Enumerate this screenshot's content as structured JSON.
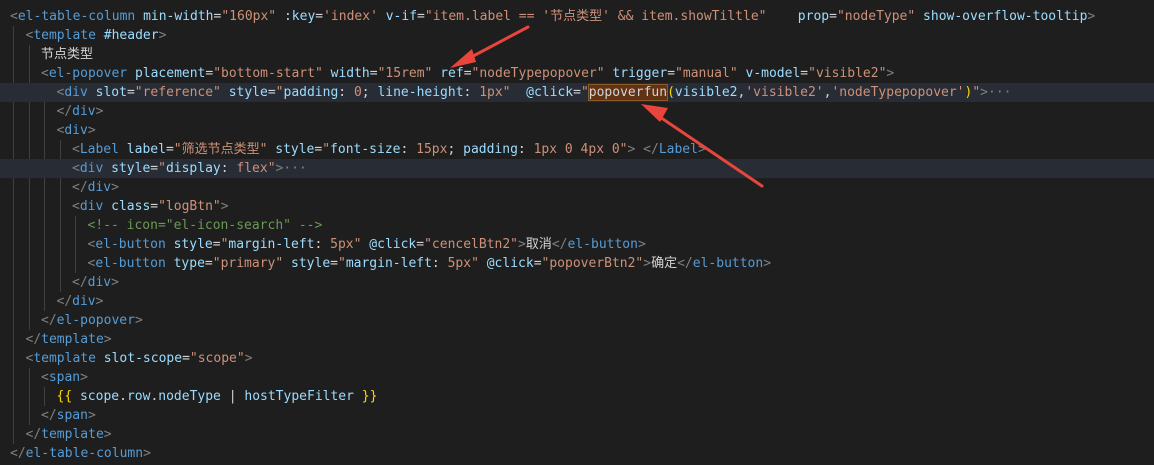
{
  "colors": {
    "background": "#1e1e1e",
    "tag": "#569cd6",
    "attribute": "#9cdcfe",
    "string": "#ce9178",
    "text": "#d4d4d4",
    "comment": "#6a9955",
    "bracket": "#ffd700",
    "annotation_arrow": "#e8463c"
  },
  "code_lines": [
    {
      "indent": 0,
      "highlight": false,
      "tokens": [
        {
          "t": "punc",
          "v": "<"
        },
        {
          "t": "tag",
          "v": "el-table-column"
        },
        {
          "t": "text",
          "v": " "
        },
        {
          "t": "attr",
          "v": "min-width"
        },
        {
          "t": "text",
          "v": "="
        },
        {
          "t": "str",
          "v": "\"160px\""
        },
        {
          "t": "text",
          "v": " "
        },
        {
          "t": "attr",
          "v": ":key"
        },
        {
          "t": "text",
          "v": "="
        },
        {
          "t": "str",
          "v": "'index'"
        },
        {
          "t": "text",
          "v": " "
        },
        {
          "t": "attr",
          "v": "v-if"
        },
        {
          "t": "text",
          "v": "="
        },
        {
          "t": "str",
          "v": "\"item.label == "
        },
        {
          "t": "str",
          "v": "'节点类型'"
        },
        {
          "t": "str",
          "v": " && item.showTiltle\""
        },
        {
          "t": "text",
          "v": "    "
        },
        {
          "t": "attr",
          "v": "prop"
        },
        {
          "t": "text",
          "v": "="
        },
        {
          "t": "str",
          "v": "\"nodeType\""
        },
        {
          "t": "text",
          "v": " "
        },
        {
          "t": "attr",
          "v": "show-overflow-tooltip"
        },
        {
          "t": "punc",
          "v": ">"
        }
      ]
    },
    {
      "indent": 1,
      "highlight": false,
      "tokens": [
        {
          "t": "punc",
          "v": "<"
        },
        {
          "t": "tag",
          "v": "template"
        },
        {
          "t": "text",
          "v": " "
        },
        {
          "t": "attr",
          "v": "#header"
        },
        {
          "t": "punc",
          "v": ">"
        }
      ]
    },
    {
      "indent": 2,
      "highlight": false,
      "tokens": [
        {
          "t": "text",
          "v": "节点类型"
        }
      ]
    },
    {
      "indent": 2,
      "highlight": false,
      "tokens": [
        {
          "t": "punc",
          "v": "<"
        },
        {
          "t": "tag",
          "v": "el-popover"
        },
        {
          "t": "text",
          "v": " "
        },
        {
          "t": "attr",
          "v": "placement"
        },
        {
          "t": "text",
          "v": "="
        },
        {
          "t": "str",
          "v": "\"bottom-start\""
        },
        {
          "t": "text",
          "v": " "
        },
        {
          "t": "attr",
          "v": "width"
        },
        {
          "t": "text",
          "v": "="
        },
        {
          "t": "str",
          "v": "\"15rem\""
        },
        {
          "t": "text",
          "v": " "
        },
        {
          "t": "attr",
          "v": "ref"
        },
        {
          "t": "text",
          "v": "="
        },
        {
          "t": "str",
          "v": "\"nodeTypepopover\""
        },
        {
          "t": "text",
          "v": " "
        },
        {
          "t": "attr",
          "v": "trigger"
        },
        {
          "t": "text",
          "v": "="
        },
        {
          "t": "str",
          "v": "\"manual\""
        },
        {
          "t": "text",
          "v": " "
        },
        {
          "t": "attr",
          "v": "v-model"
        },
        {
          "t": "text",
          "v": "="
        },
        {
          "t": "str",
          "v": "\"visible2\""
        },
        {
          "t": "punc",
          "v": ">"
        }
      ]
    },
    {
      "indent": 3,
      "highlight": true,
      "tokens": [
        {
          "t": "punc",
          "v": "<"
        },
        {
          "t": "tag",
          "v": "div"
        },
        {
          "t": "text",
          "v": " "
        },
        {
          "t": "attr",
          "v": "slot"
        },
        {
          "t": "text",
          "v": "="
        },
        {
          "t": "str",
          "v": "\"reference\""
        },
        {
          "t": "text",
          "v": " "
        },
        {
          "t": "attr",
          "v": "style"
        },
        {
          "t": "text",
          "v": "="
        },
        {
          "t": "str",
          "v": "\""
        },
        {
          "t": "attr",
          "v": "padding"
        },
        {
          "t": "text",
          "v": ": "
        },
        {
          "t": "str",
          "v": "0"
        },
        {
          "t": "text",
          "v": "; "
        },
        {
          "t": "attr",
          "v": "line-height"
        },
        {
          "t": "text",
          "v": ": "
        },
        {
          "t": "str",
          "v": "1px"
        },
        {
          "t": "str",
          "v": "\""
        },
        {
          "t": "text",
          "v": "  "
        },
        {
          "t": "attr",
          "v": "@click"
        },
        {
          "t": "text",
          "v": "="
        },
        {
          "t": "str",
          "v": "\""
        },
        {
          "t": "match",
          "v": "popoverfun"
        },
        {
          "t": "gold",
          "v": "("
        },
        {
          "t": "attr",
          "v": "visible2"
        },
        {
          "t": "text",
          "v": ","
        },
        {
          "t": "str",
          "v": "'visible2'"
        },
        {
          "t": "text",
          "v": ","
        },
        {
          "t": "str",
          "v": "'nodeTypepopover'"
        },
        {
          "t": "gold",
          "v": ")"
        },
        {
          "t": "str",
          "v": "\""
        },
        {
          "t": "punc",
          "v": ">"
        },
        {
          "t": "fold",
          "v": "···"
        }
      ]
    },
    {
      "indent": 3,
      "highlight": false,
      "tokens": [
        {
          "t": "punc",
          "v": "</"
        },
        {
          "t": "tag",
          "v": "div"
        },
        {
          "t": "punc",
          "v": ">"
        }
      ]
    },
    {
      "indent": 3,
      "highlight": false,
      "tokens": [
        {
          "t": "punc",
          "v": "<"
        },
        {
          "t": "tag",
          "v": "div"
        },
        {
          "t": "punc",
          "v": ">"
        }
      ]
    },
    {
      "indent": 4,
      "highlight": false,
      "tokens": [
        {
          "t": "punc",
          "v": "<"
        },
        {
          "t": "tag",
          "v": "Label"
        },
        {
          "t": "text",
          "v": " "
        },
        {
          "t": "attr",
          "v": "label"
        },
        {
          "t": "text",
          "v": "="
        },
        {
          "t": "str",
          "v": "\"筛选节点类型\""
        },
        {
          "t": "text",
          "v": " "
        },
        {
          "t": "attr",
          "v": "style"
        },
        {
          "t": "text",
          "v": "="
        },
        {
          "t": "str",
          "v": "\""
        },
        {
          "t": "attr",
          "v": "font-size"
        },
        {
          "t": "text",
          "v": ": "
        },
        {
          "t": "str",
          "v": "15px"
        },
        {
          "t": "text",
          "v": "; "
        },
        {
          "t": "attr",
          "v": "padding"
        },
        {
          "t": "text",
          "v": ": "
        },
        {
          "t": "str",
          "v": "1px 0 4px 0"
        },
        {
          "t": "str",
          "v": "\""
        },
        {
          "t": "punc",
          "v": ">"
        },
        {
          "t": "text",
          "v": " "
        },
        {
          "t": "punc",
          "v": "</"
        },
        {
          "t": "tag",
          "v": "Label"
        },
        {
          "t": "punc",
          "v": ">"
        }
      ]
    },
    {
      "indent": 4,
      "highlight": true,
      "tokens": [
        {
          "t": "punc",
          "v": "<"
        },
        {
          "t": "tag",
          "v": "div"
        },
        {
          "t": "text",
          "v": " "
        },
        {
          "t": "attr",
          "v": "style"
        },
        {
          "t": "text",
          "v": "="
        },
        {
          "t": "str",
          "v": "\""
        },
        {
          "t": "attr",
          "v": "display"
        },
        {
          "t": "text",
          "v": ": "
        },
        {
          "t": "str",
          "v": "flex"
        },
        {
          "t": "str",
          "v": "\""
        },
        {
          "t": "punc",
          "v": ">"
        },
        {
          "t": "fold",
          "v": "···"
        }
      ]
    },
    {
      "indent": 4,
      "highlight": false,
      "tokens": [
        {
          "t": "punc",
          "v": "</"
        },
        {
          "t": "tag",
          "v": "div"
        },
        {
          "t": "punc",
          "v": ">"
        }
      ]
    },
    {
      "indent": 4,
      "highlight": false,
      "tokens": [
        {
          "t": "punc",
          "v": "<"
        },
        {
          "t": "tag",
          "v": "div"
        },
        {
          "t": "text",
          "v": " "
        },
        {
          "t": "attr",
          "v": "class"
        },
        {
          "t": "text",
          "v": "="
        },
        {
          "t": "str",
          "v": "\"logBtn\""
        },
        {
          "t": "punc",
          "v": ">"
        }
      ]
    },
    {
      "indent": 5,
      "highlight": false,
      "tokens": [
        {
          "t": "cmt",
          "v": "<!-- icon=\"el-icon-search\" -->"
        }
      ]
    },
    {
      "indent": 5,
      "highlight": false,
      "tokens": [
        {
          "t": "punc",
          "v": "<"
        },
        {
          "t": "tag",
          "v": "el-button"
        },
        {
          "t": "text",
          "v": " "
        },
        {
          "t": "attr",
          "v": "style"
        },
        {
          "t": "text",
          "v": "="
        },
        {
          "t": "str",
          "v": "\""
        },
        {
          "t": "attr",
          "v": "margin-left"
        },
        {
          "t": "text",
          "v": ": "
        },
        {
          "t": "str",
          "v": "5px"
        },
        {
          "t": "str",
          "v": "\""
        },
        {
          "t": "text",
          "v": " "
        },
        {
          "t": "attr",
          "v": "@click"
        },
        {
          "t": "text",
          "v": "="
        },
        {
          "t": "str",
          "v": "\"cencelBtn2\""
        },
        {
          "t": "punc",
          "v": ">"
        },
        {
          "t": "text",
          "v": "取消"
        },
        {
          "t": "punc",
          "v": "</"
        },
        {
          "t": "tag",
          "v": "el-button"
        },
        {
          "t": "punc",
          "v": ">"
        }
      ]
    },
    {
      "indent": 5,
      "highlight": false,
      "tokens": [
        {
          "t": "punc",
          "v": "<"
        },
        {
          "t": "tag",
          "v": "el-button"
        },
        {
          "t": "text",
          "v": " "
        },
        {
          "t": "attr",
          "v": "type"
        },
        {
          "t": "text",
          "v": "="
        },
        {
          "t": "str",
          "v": "\"primary\""
        },
        {
          "t": "text",
          "v": " "
        },
        {
          "t": "attr",
          "v": "style"
        },
        {
          "t": "text",
          "v": "="
        },
        {
          "t": "str",
          "v": "\""
        },
        {
          "t": "attr",
          "v": "margin-left"
        },
        {
          "t": "text",
          "v": ": "
        },
        {
          "t": "str",
          "v": "5px"
        },
        {
          "t": "str",
          "v": "\""
        },
        {
          "t": "text",
          "v": " "
        },
        {
          "t": "attr",
          "v": "@click"
        },
        {
          "t": "text",
          "v": "="
        },
        {
          "t": "str",
          "v": "\"popoverBtn2\""
        },
        {
          "t": "punc",
          "v": ">"
        },
        {
          "t": "text",
          "v": "确定"
        },
        {
          "t": "punc",
          "v": "</"
        },
        {
          "t": "tag",
          "v": "el-button"
        },
        {
          "t": "punc",
          "v": ">"
        }
      ]
    },
    {
      "indent": 4,
      "highlight": false,
      "tokens": [
        {
          "t": "punc",
          "v": "</"
        },
        {
          "t": "tag",
          "v": "div"
        },
        {
          "t": "punc",
          "v": ">"
        }
      ]
    },
    {
      "indent": 3,
      "highlight": false,
      "tokens": [
        {
          "t": "punc",
          "v": "</"
        },
        {
          "t": "tag",
          "v": "div"
        },
        {
          "t": "punc",
          "v": ">"
        }
      ]
    },
    {
      "indent": 2,
      "highlight": false,
      "tokens": [
        {
          "t": "punc",
          "v": "</"
        },
        {
          "t": "tag",
          "v": "el-popover"
        },
        {
          "t": "punc",
          "v": ">"
        }
      ]
    },
    {
      "indent": 1,
      "highlight": false,
      "tokens": [
        {
          "t": "punc",
          "v": "</"
        },
        {
          "t": "tag",
          "v": "template"
        },
        {
          "t": "punc",
          "v": ">"
        }
      ]
    },
    {
      "indent": 1,
      "highlight": false,
      "tokens": [
        {
          "t": "punc",
          "v": "<"
        },
        {
          "t": "tag",
          "v": "template"
        },
        {
          "t": "text",
          "v": " "
        },
        {
          "t": "attr",
          "v": "slot-scope"
        },
        {
          "t": "text",
          "v": "="
        },
        {
          "t": "str",
          "v": "\"scope\""
        },
        {
          "t": "punc",
          "v": ">"
        }
      ]
    },
    {
      "indent": 2,
      "highlight": false,
      "tokens": [
        {
          "t": "punc",
          "v": "<"
        },
        {
          "t": "tag",
          "v": "span"
        },
        {
          "t": "punc",
          "v": ">"
        }
      ]
    },
    {
      "indent": 3,
      "highlight": false,
      "tokens": [
        {
          "t": "gold",
          "v": "{{"
        },
        {
          "t": "text",
          "v": " "
        },
        {
          "t": "attr",
          "v": "scope"
        },
        {
          "t": "text",
          "v": "."
        },
        {
          "t": "attr",
          "v": "row"
        },
        {
          "t": "text",
          "v": "."
        },
        {
          "t": "attr",
          "v": "nodeType"
        },
        {
          "t": "text",
          "v": " | "
        },
        {
          "t": "attr",
          "v": "hostTypeFilter"
        },
        {
          "t": "text",
          "v": " "
        },
        {
          "t": "gold",
          "v": "}}"
        }
      ]
    },
    {
      "indent": 2,
      "highlight": false,
      "tokens": [
        {
          "t": "punc",
          "v": "</"
        },
        {
          "t": "tag",
          "v": "span"
        },
        {
          "t": "punc",
          "v": ">"
        }
      ]
    },
    {
      "indent": 1,
      "highlight": false,
      "tokens": [
        {
          "t": "punc",
          "v": "</"
        },
        {
          "t": "tag",
          "v": "template"
        },
        {
          "t": "punc",
          "v": ">"
        }
      ]
    },
    {
      "indent": 0,
      "highlight": false,
      "tokens": [
        {
          "t": "punc",
          "v": "</"
        },
        {
          "t": "tag",
          "v": "el-table-column"
        },
        {
          "t": "punc",
          "v": ">"
        }
      ]
    }
  ]
}
